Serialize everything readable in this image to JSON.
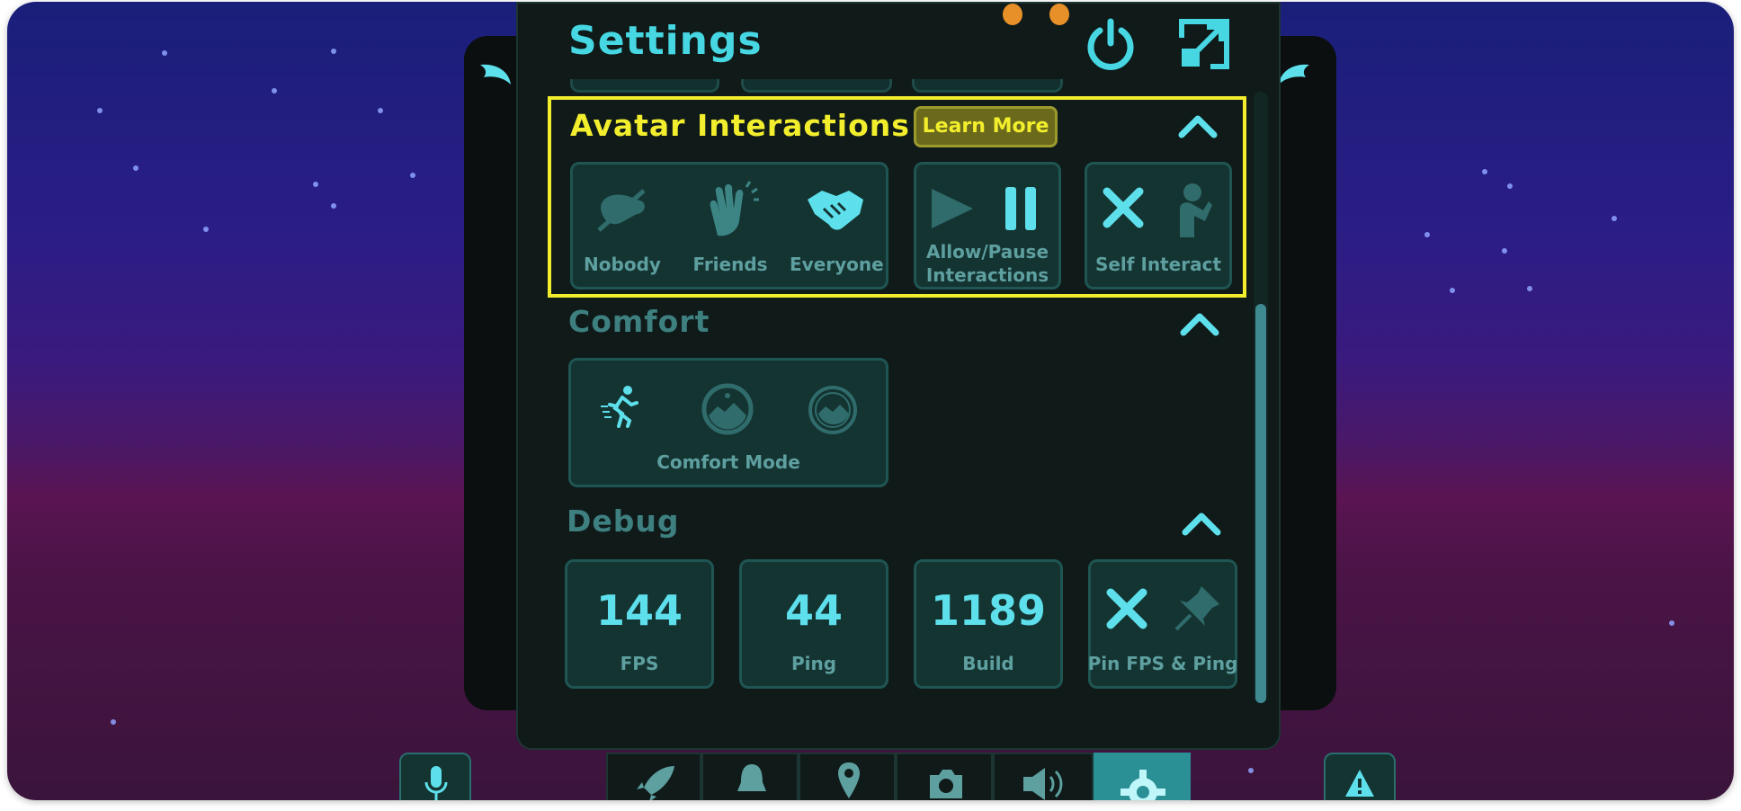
{
  "colors": {
    "accent": "#46d7e3",
    "highlight": "#f2ee2d",
    "muted": "#5e9fa0",
    "panel": "#0f1a19"
  },
  "header": {
    "title": "Settings",
    "power_icon": "power-icon",
    "expand_icon": "expand-icon"
  },
  "avatar_interactions": {
    "title": "Avatar Interactions",
    "learn_more": "Learn More",
    "options": [
      "Nobody",
      "Friends",
      "Everyone"
    ],
    "allow_pause_line1": "Allow/Pause",
    "allow_pause_line2": "Interactions",
    "self_interact": "Self Interact"
  },
  "comfort": {
    "title": "Comfort",
    "mode_label": "Comfort Mode"
  },
  "debug": {
    "title": "Debug",
    "stats": [
      {
        "value": "144",
        "label": "FPS"
      },
      {
        "value": "44",
        "label": "Ping"
      },
      {
        "value": "1189",
        "label": "Build"
      }
    ],
    "pin_label": "Pin FPS & Ping"
  },
  "bottom_bar": {
    "icons": [
      "rocket-icon",
      "bell-icon",
      "location-icon",
      "camera-icon",
      "speaker-icon",
      "gear-icon"
    ],
    "left": "microphone-icon",
    "right": "warning-icon"
  }
}
